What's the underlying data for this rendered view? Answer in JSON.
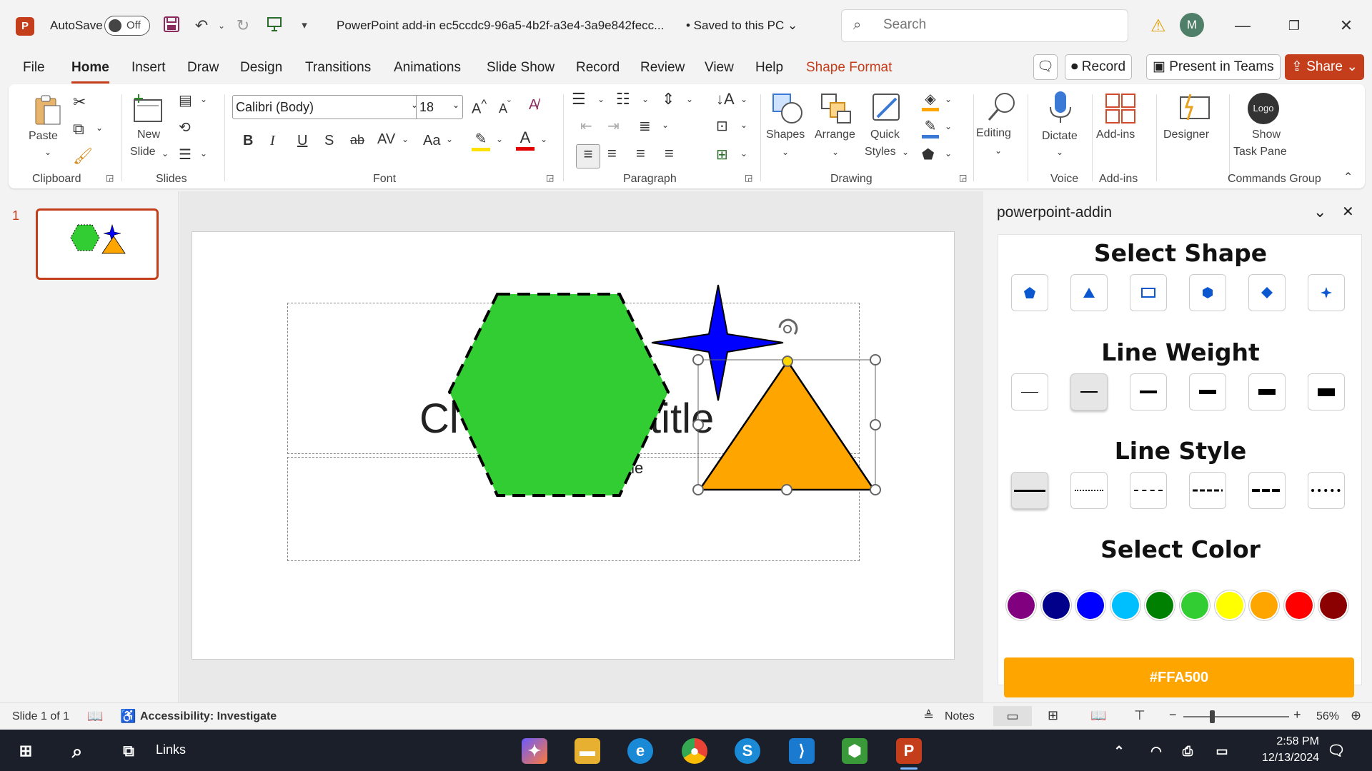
{
  "titlebar": {
    "app_icon": "P",
    "autosave_label": "AutoSave",
    "autosave_state": "Off",
    "document_title": "PowerPoint add-in ec5ccdc9-96a5-4b2f-a3e4-3a9e842fecc...",
    "saved_status": "• Saved to this PC",
    "search_placeholder": "Search",
    "user_initial": "M"
  },
  "menu": {
    "tabs": [
      "File",
      "Home",
      "Insert",
      "Draw",
      "Design",
      "Transitions",
      "Animations",
      "Slide Show",
      "Record",
      "Review",
      "View",
      "Help",
      "Shape Format"
    ],
    "active_tab": "Home",
    "record_label": "Record",
    "present_label": "Present in Teams",
    "share_label": "Share"
  },
  "ribbon": {
    "paste_label": "Paste",
    "new_slide_label": "New",
    "new_slide_label2": "Slide",
    "font_name": "Calibri (Body)",
    "font_size": "18",
    "shapes_label": "Shapes",
    "arrange_label": "Arrange",
    "quick_styles_label": "Quick",
    "quick_styles_label2": "Styles",
    "editing_label": "Editing",
    "dictate_label": "Dictate",
    "addins_label": "Add-ins",
    "designer_label": "Designer",
    "logo_text": "Logo",
    "show_taskpane_label": "Show",
    "show_taskpane_label2": "Task Pane",
    "groups": {
      "clipboard": "Clipboard",
      "slides": "Slides",
      "font": "Font",
      "paragraph": "Paragraph",
      "drawing": "Drawing",
      "voice": "Voice",
      "addins": "Add-ins",
      "commands": "Commands Group"
    }
  },
  "thumbnails": {
    "slide_number": "1"
  },
  "slide": {
    "title_visible": "Cl",
    "title_visible2": "title",
    "subtitle_visible": "tle"
  },
  "taskpane": {
    "title": "powerpoint-addin",
    "select_shape": "Select Shape",
    "line_weight": "Line Weight",
    "line_style": "Line Style",
    "select_color": "Select Color",
    "colors": [
      "#800080",
      "#00008b",
      "#0000ff",
      "#00bfff",
      "#008000",
      "#32cd32",
      "#ffff00",
      "#ffa500",
      "#ff0000",
      "#8b0000"
    ],
    "selected_color": "#FFA500"
  },
  "status": {
    "slide_info": "Slide 1 of 1",
    "accessibility": "Accessibility: Investigate",
    "notes": "Notes",
    "zoom": "56%"
  },
  "taskbar": {
    "links_label": "Links",
    "time": "2:58 PM",
    "date": "12/13/2024"
  }
}
